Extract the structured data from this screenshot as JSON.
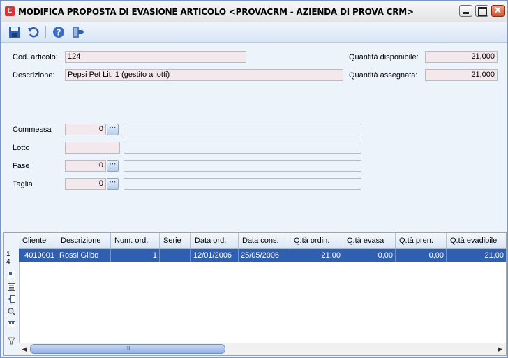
{
  "window": {
    "title": "MODIFICA PROPOSTA DI EVASIONE ARTICOLO <PROVACRM - AZIENDA DI PROVA CRM>",
    "app_icon_letter": "E"
  },
  "toolbar": {
    "buttons": [
      "save-icon",
      "undo-icon",
      "help-icon",
      "exit-icon"
    ]
  },
  "form": {
    "cod_articolo": {
      "label": "Cod. articolo:",
      "value": "124"
    },
    "descrizione": {
      "label": "Descrizione:",
      "value": "Pepsi Pet Lit. 1 (gestito a lotti)"
    },
    "quantita_disponibile": {
      "label": "Quantità disponibile:",
      "value": "21,000"
    },
    "quantita_assegnata": {
      "label": "Quantità assegnata:",
      "value": "21,000"
    },
    "commessa": {
      "label": "Commessa",
      "value": "0",
      "desc": ""
    },
    "lotto": {
      "label": "Lotto",
      "value": "",
      "desc": ""
    },
    "fase": {
      "label": "Fase",
      "value": "0",
      "desc": ""
    },
    "taglia": {
      "label": "Taglia",
      "value": "0",
      "desc": ""
    },
    "lookup_glyph": "···"
  },
  "grid": {
    "columns": [
      "Cliente",
      "Descrizione",
      "Num. ord.",
      "Serie",
      "Data ord.",
      "Data cons.",
      "Q.tà ordin.",
      "Q.tà evasa",
      "Q.tà pren.",
      "Q.tà evadibile"
    ],
    "rows": [
      {
        "cliente": "4010001",
        "descrizione": "Rossi Gilbo",
        "num_ord": "1",
        "serie": "",
        "data_ord": "12/01/2006",
        "data_cons": "25/05/2006",
        "qta_ordin": "21,00",
        "qta_evasa": "0,00",
        "qta_pren": "0,00",
        "qta_evadibile": "21,00"
      }
    ],
    "row_counter_top": "1",
    "row_counter_bottom": "4",
    "scroll_grip": "III"
  },
  "colors": {
    "accent": "#2f5fb0",
    "field_bg": "#f3e9ec",
    "panel_bg": "#ECF3FB"
  }
}
